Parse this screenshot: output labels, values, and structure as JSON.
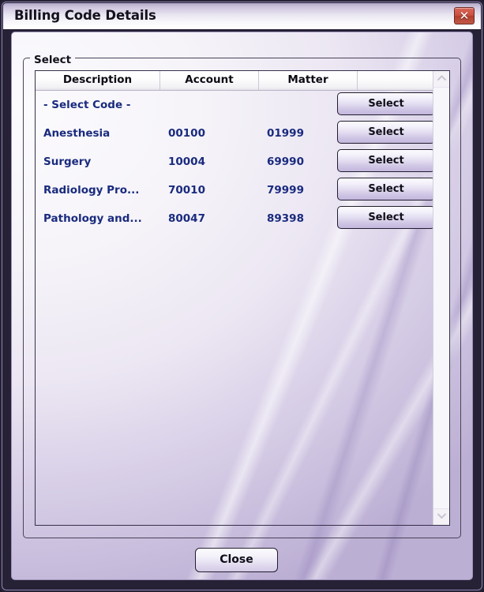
{
  "window": {
    "title": "Billing Code Details",
    "close_icon": "close-x-icon",
    "close_glyph": "✕"
  },
  "groupbox": {
    "label": "Select"
  },
  "grid": {
    "columns": [
      "Description",
      "Account",
      "Matter",
      ""
    ],
    "rows": [
      {
        "description": "- Select Code -",
        "account": "",
        "matter": "",
        "action": "Select"
      },
      {
        "description": "Anesthesia",
        "account": "00100",
        "matter": "01999",
        "action": "Select"
      },
      {
        "description": "Surgery",
        "account": "10004",
        "matter": "69990",
        "action": "Select"
      },
      {
        "description": "Radiology Pro...",
        "account": "70010",
        "matter": "79999",
        "action": "Select"
      },
      {
        "description": "Pathology and...",
        "account": "80047",
        "matter": "89398",
        "action": "Select"
      }
    ]
  },
  "scrollbar": {
    "up_icon": "chevron-up-icon",
    "down_icon": "chevron-down-icon"
  },
  "footer": {
    "close_label": "Close"
  },
  "colors": {
    "accent": "#b3a9c9",
    "row_text": "#1a2b7e",
    "close_button": "#c8503f",
    "frame": "#262135"
  }
}
